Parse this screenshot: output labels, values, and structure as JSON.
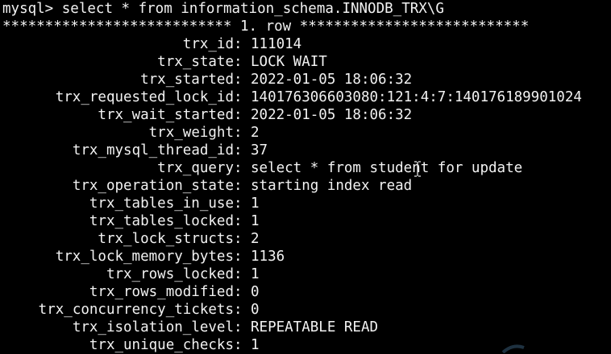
{
  "terminal": {
    "prompt": "mysql> ",
    "command": "select * from information_schema.INNODB_TRX\\G",
    "separator": "*************************** 1. row ***************************",
    "rows": [
      {
        "field": "trx_id",
        "value": "111014"
      },
      {
        "field": "trx_state",
        "value": "LOCK WAIT"
      },
      {
        "field": "trx_started",
        "value": "2022-01-05 18:06:32"
      },
      {
        "field": "trx_requested_lock_id",
        "value": "140176306603080:121:4:7:140176189901024"
      },
      {
        "field": "trx_wait_started",
        "value": "2022-01-05 18:06:32"
      },
      {
        "field": "trx_weight",
        "value": "2"
      },
      {
        "field": "trx_mysql_thread_id",
        "value": "37"
      },
      {
        "field": "trx_query",
        "value": "select * from student for update"
      },
      {
        "field": "trx_operation_state",
        "value": "starting index read"
      },
      {
        "field": "trx_tables_in_use",
        "value": "1"
      },
      {
        "field": "trx_tables_locked",
        "value": "1"
      },
      {
        "field": "trx_lock_structs",
        "value": "2"
      },
      {
        "field": "trx_lock_memory_bytes",
        "value": "1136"
      },
      {
        "field": "trx_rows_locked",
        "value": "1"
      },
      {
        "field": "trx_rows_modified",
        "value": "0"
      },
      {
        "field": "trx_concurrency_tickets",
        "value": "0"
      },
      {
        "field": "trx_isolation_level",
        "value": "REPEATABLE READ"
      },
      {
        "field": "trx_unique_checks",
        "value": "1"
      }
    ]
  },
  "colors": {
    "background": "#000000",
    "text": "#f2f2f2"
  },
  "icons": {
    "cursor": "text-cursor-icon"
  }
}
